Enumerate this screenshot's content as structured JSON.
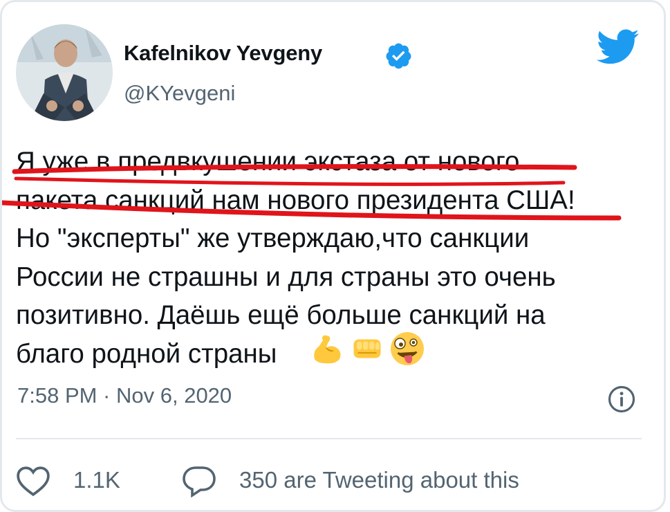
{
  "tweet": {
    "author_name": "Kafelnikov Yevgeny",
    "author_handle": "@KYevgeni",
    "verified": true,
    "body": "Я уже в предвкушении экстаза от нового\nпакета санкций нам нового президента США!\nНо \"эксперты\" же утверждаю,что санкции\nРоссии не страшны и для страны это очень\nпозитивно. Даёшь ещё больше санкций на\nблаго родной страны",
    "emojis": [
      "flexed-biceps",
      "oncoming-fist",
      "zany-face"
    ],
    "timestamp": "7:58 PM · Nov 6, 2020",
    "likes": "1.1K",
    "conversation": "350 are Tweeting about this"
  },
  "colors": {
    "brand_blue": "#1d9bf0",
    "secondary_text": "#536471",
    "annotation_red": "#e0141b",
    "border": "#e3e8ec"
  },
  "icons": {
    "brand": "twitter-bird-icon",
    "verified": "verified-badge-icon",
    "info": "info-icon",
    "like": "heart-icon",
    "reply": "speech-bubble-icon"
  }
}
